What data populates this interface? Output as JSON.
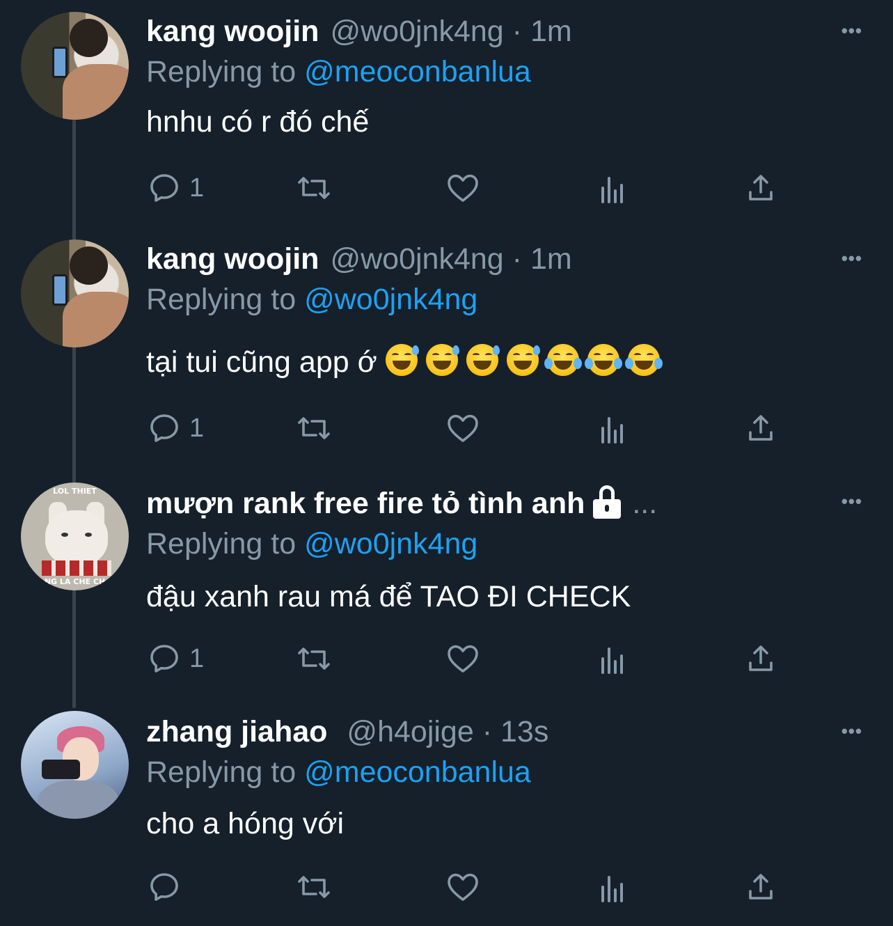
{
  "tweets": [
    {
      "name": "kang woojin",
      "handle": "@wo0jnk4ng",
      "time_sep": "·",
      "time": "1m",
      "replying_to_label": "Replying to",
      "replying_to": "@meoconbanlua",
      "text": "hnhu có r đó chế",
      "reply_count": "1",
      "avatar": "profile-photo-person-with-phone"
    },
    {
      "name": "kang woojin",
      "handle": "@wo0jnk4ng",
      "time_sep": "·",
      "time": "1m",
      "replying_to_label": "Replying to",
      "replying_to": "@wo0jnk4ng",
      "text": "tại tui cũng app ớ",
      "emojis": [
        "grinning-sweat",
        "grinning-sweat",
        "grinning-sweat",
        "grinning-sweat",
        "tears-of-joy",
        "tears-of-joy",
        "tears-of-joy"
      ],
      "reply_count": "1",
      "avatar": "profile-photo-person-with-phone"
    },
    {
      "name": "mượn rank free fire tỏ tình anh",
      "protected_icon": "lock-icon",
      "truncation": "...",
      "replying_to_label": "Replying to",
      "replying_to": "@wo0jnk4ng",
      "text": "đậu xanh rau má để TAO ĐI CHECK",
      "reply_count": "1",
      "avatar": "profile-photo-cat-meme",
      "avatar_caption_top": "LOL THIET",
      "avatar_caption_bottom": "NG LA CHE CH"
    },
    {
      "name": "zhang jiahao",
      "handle": "@h4ojige",
      "time_sep": "·",
      "time": "13s",
      "replying_to_label": "Replying to",
      "replying_to": "@meoconbanlua",
      "text": "cho a hóng với",
      "reply_count": "",
      "avatar": "profile-photo-person-pink-hair"
    }
  ],
  "more_label": "•••",
  "icons": [
    "reply-icon",
    "retweet-icon",
    "like-icon",
    "analytics-icon",
    "share-icon"
  ],
  "colors": {
    "background": "#15202b",
    "secondary_text": "#8899a6",
    "mention": "#1da1f2",
    "thread_line": "#38444d"
  }
}
